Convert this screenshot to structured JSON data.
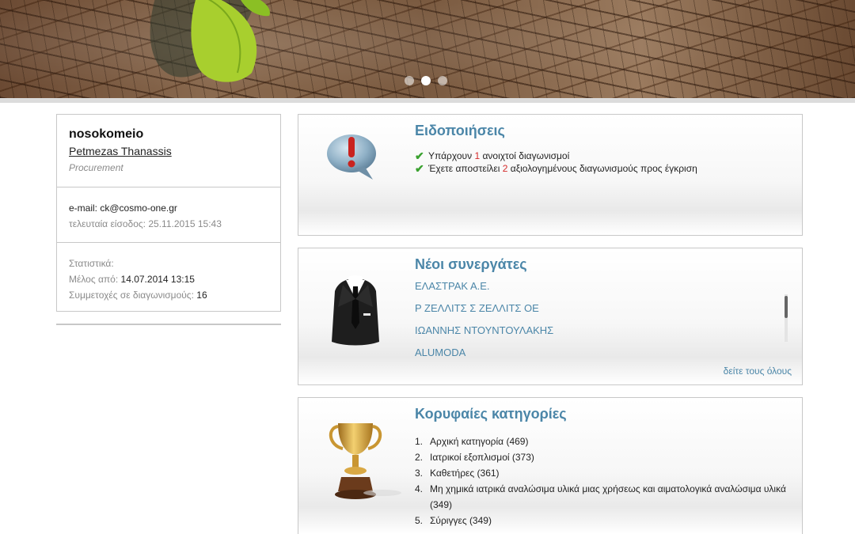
{
  "banner": {
    "slides": [
      {
        "icon": "carousel-dot-icon",
        "active": false
      },
      {
        "icon": "carousel-dot-icon",
        "active": true
      },
      {
        "icon": "carousel-dot-icon",
        "active": false
      }
    ]
  },
  "profile": {
    "org": "nosokomeio",
    "user": "Petmezas Thanassis",
    "department": "Procurement",
    "email_label": "e-mail:",
    "email": "ck@cosmo-one.gr",
    "last_login_label": "τελευταία είσοδος:",
    "last_login": "25.11.2015 15:43",
    "stats_label": "Στατιστικά:",
    "member_since_label": "Μέλος από:",
    "member_since": "14.07.2014 13:15",
    "participations_label": "Συμμετοχές σε διαγωνισμούς:",
    "participations": "16"
  },
  "notifications": {
    "icon": "speech-bubble-exclamation-icon",
    "title": "Ειδοποιήσεις",
    "items": [
      {
        "icon": "checkmark-icon",
        "pre": "Υπάρχουν",
        "count": "1",
        "post": "ανοιχτοί διαγωνισμοί"
      },
      {
        "icon": "checkmark-icon",
        "pre": "Έχετε αποστείλει",
        "count": "2",
        "post": "αξιολογημένους διαγωνισμούς προς έγκριση"
      }
    ]
  },
  "partners": {
    "icon": "business-suit-icon",
    "title": "Νέοι συνεργάτες",
    "items": [
      "ΕΛΑΣΤΡΑΚ Α.Ε.",
      "Ρ ΖΕΛΛΙΤΣ Σ ΖΕΛΛΙΤΣ ΟΕ",
      "ΙΩΑΝΝΗΣ ΝΤΟΥΝΤΟΥΛΑΚΗΣ",
      "ALUMODA"
    ],
    "see_all": "δείτε τους όλους"
  },
  "categories": {
    "icon": "trophy-icon",
    "title": "Κορυφαίες κατηγορίες",
    "items": [
      {
        "n": "1.",
        "label": "Αρχική κατηγορία (469)"
      },
      {
        "n": "2.",
        "label": "Ιατρικοί εξοπλισμοί (373)"
      },
      {
        "n": "3.",
        "label": "Καθετήρες (361)"
      },
      {
        "n": "4.",
        "label": "Μη χημικά ιατρικά αναλώσιμα υλικά μιας χρήσεως και αιματολογικά αναλώσιμα υλικά (349)"
      },
      {
        "n": "5.",
        "label": "Σύριγγες (349)"
      }
    ]
  },
  "colors": {
    "accent": "#4b86a8",
    "highlight": "#d42a2a",
    "check": "#3aa12f"
  }
}
